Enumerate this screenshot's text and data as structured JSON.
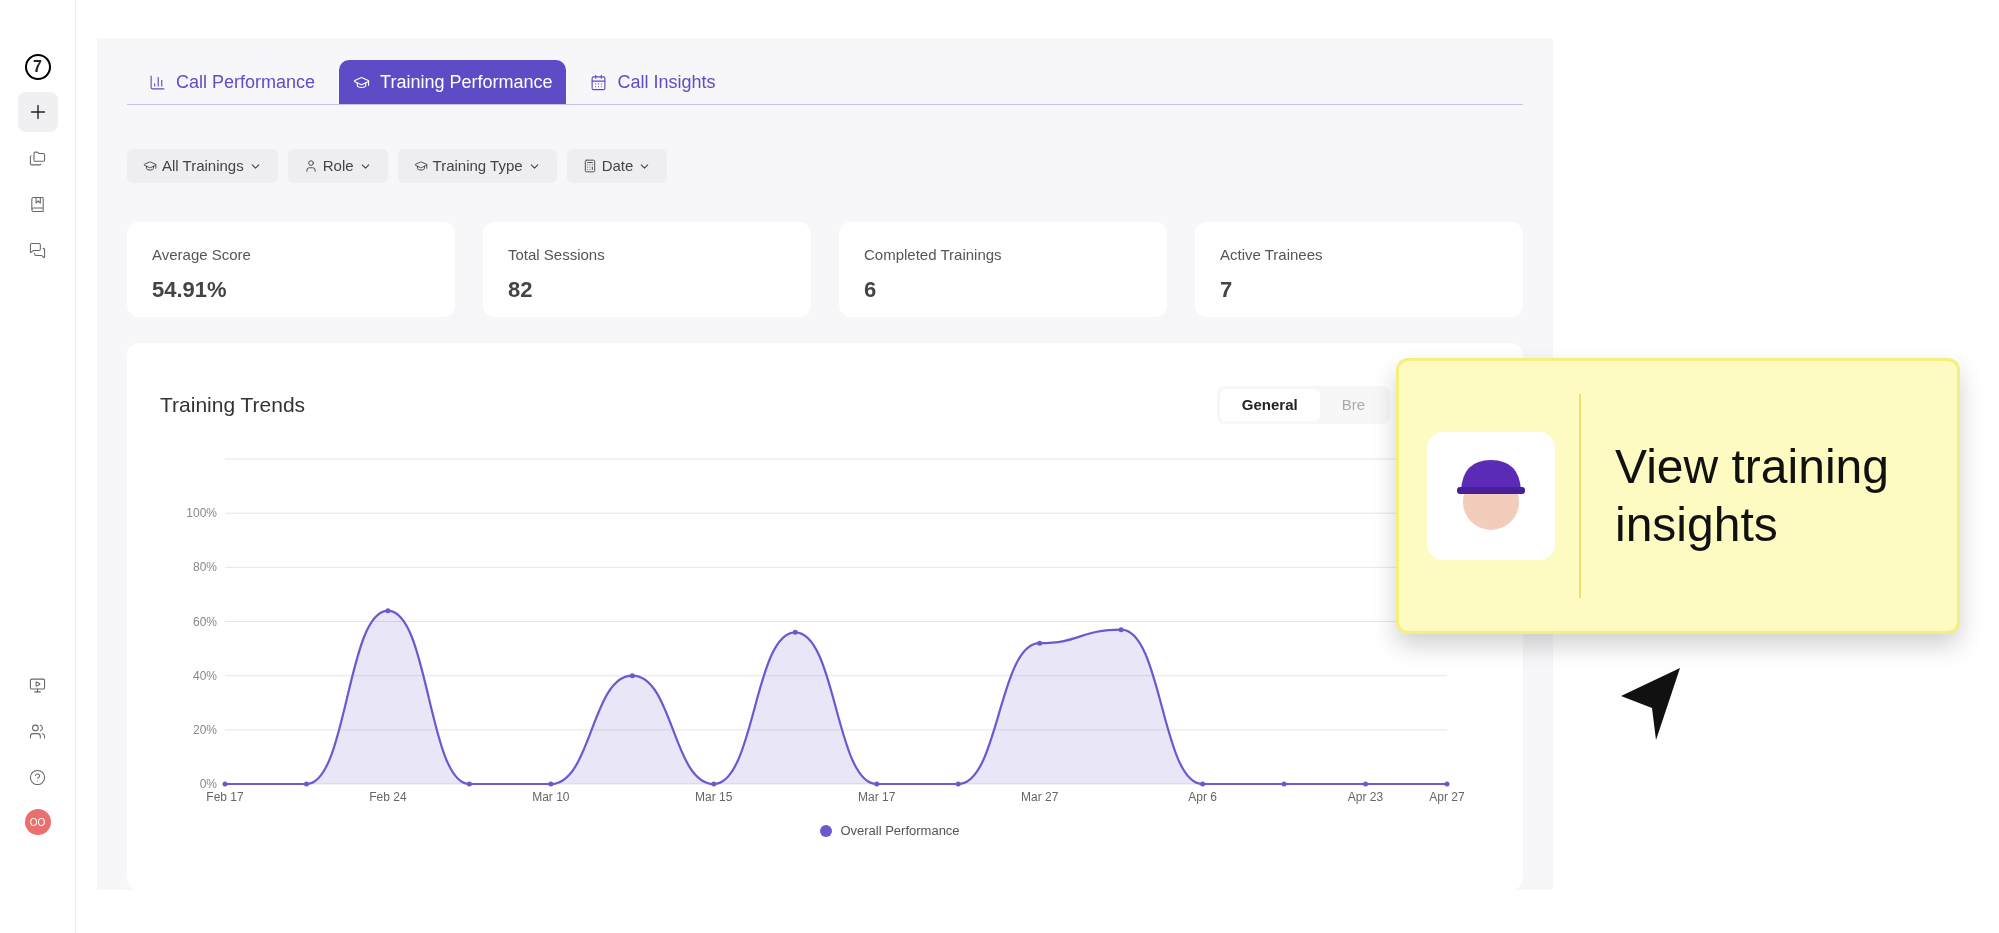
{
  "sidebar": {
    "logo": "7",
    "items": [
      {
        "selected": true
      },
      {
        "selected": false
      },
      {
        "selected": false
      },
      {
        "selected": false
      }
    ],
    "bottom_items": [
      {
        "selected": false
      },
      {
        "selected": false
      },
      {
        "selected": false
      }
    ],
    "avatar": {
      "initials": "OO",
      "color": "#ea6f6f"
    }
  },
  "tabs": [
    {
      "label": "Call Performance",
      "selected": false
    },
    {
      "label": "Training Performance",
      "selected": true
    },
    {
      "label": "Call Insights",
      "selected": false
    }
  ],
  "filters": [
    {
      "label": "All Trainings"
    },
    {
      "label": "Role"
    },
    {
      "label": "Training Type"
    },
    {
      "label": "Date"
    }
  ],
  "stats": [
    {
      "label": "Average Score",
      "value": "54.91%"
    },
    {
      "label": "Total Sessions",
      "value": "82"
    },
    {
      "label": "Completed Trainings",
      "value": "6"
    },
    {
      "label": "Active Trainees",
      "value": "7"
    }
  ],
  "trends": {
    "title": "Training Trends",
    "views": [
      {
        "label": "General",
        "selected": true
      },
      {
        "label": "Bre",
        "selected": false
      }
    ],
    "chart_data": {
      "type": "area",
      "categories": [
        "Feb 17",
        null,
        "Feb 24",
        null,
        "Mar 10",
        null,
        "Mar 15",
        null,
        "Mar 17",
        null,
        "Mar 27",
        null,
        "Apr 6",
        null,
        "Apr 23",
        "Apr 27"
      ],
      "series": [
        {
          "name": "Overall Performance",
          "color": "#6a5acd",
          "values": [
            0,
            0,
            64,
            0,
            0,
            40,
            0,
            56,
            0,
            0,
            52,
            57,
            0,
            0,
            0,
            0
          ]
        }
      ],
      "ylim": [
        0,
        120
      ],
      "grid": true,
      "yticks": [
        {
          "value": 0,
          "label": "0%"
        },
        {
          "value": 20,
          "label": "20%"
        },
        {
          "value": 40,
          "label": "40%"
        },
        {
          "value": 60,
          "label": "60%"
        },
        {
          "value": 80,
          "label": "80%"
        },
        {
          "value": 100,
          "label": "100%"
        }
      ]
    }
  },
  "callout": {
    "text": "View training insights"
  }
}
